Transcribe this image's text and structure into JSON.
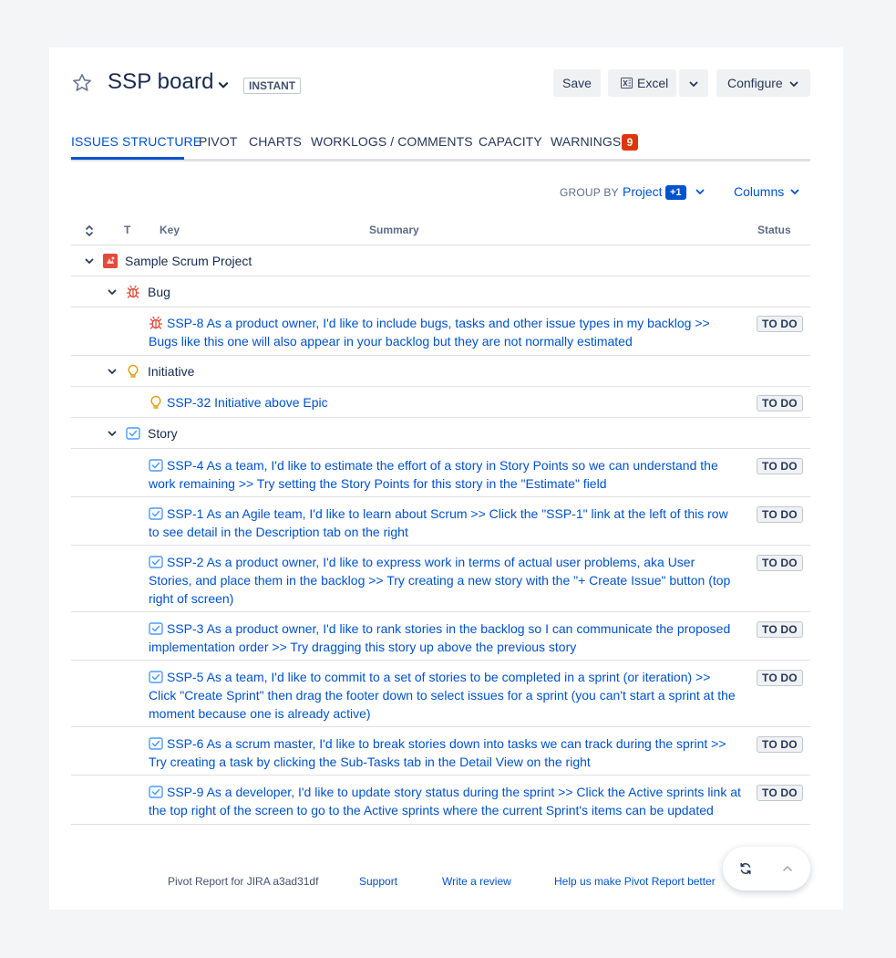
{
  "header": {
    "title": "SSP board",
    "badge": "INSTANT",
    "save_label": "Save",
    "excel_label": "Excel",
    "configure_label": "Configure"
  },
  "tabs": [
    {
      "label": "ISSUES STRUCTURE",
      "active": true
    },
    {
      "label": "PIVOT",
      "active": false
    },
    {
      "label": "CHARTS",
      "active": false
    },
    {
      "label": "WORKLOGS / COMMENTS",
      "active": false
    },
    {
      "label": "CAPACITY",
      "active": false
    },
    {
      "label": "WARNINGS",
      "active": false,
      "count": "9"
    }
  ],
  "groupby": {
    "label": "GROUP BY",
    "value": "Project",
    "extra": "+1",
    "columns_label": "Columns"
  },
  "table": {
    "headers": {
      "type": "T",
      "key": "Key",
      "summary": "Summary",
      "status": "Status"
    },
    "project": "Sample Scrum Project",
    "groups": [
      {
        "label": "Bug",
        "icon": "bug-icon",
        "issues": [
          {
            "text": "SSP-8 As a product owner, I'd like to include bugs, tasks and other issue types in my backlog >> Bugs like this one will also appear in your backlog but they are not normally estimated",
            "status": "TO DO"
          }
        ]
      },
      {
        "label": "Initiative",
        "icon": "lightbulb-icon",
        "issues": [
          {
            "text": "SSP-32 Initiative above Epic",
            "status": "TO DO"
          }
        ]
      },
      {
        "label": "Story",
        "icon": "checkbox-icon",
        "issues": [
          {
            "text": "SSP-4 As a team, I'd like to estimate the effort of a story in Story Points so we can understand the work remaining >> Try setting the Story Points for this story in the \"Estimate\" field",
            "status": "TO DO"
          },
          {
            "text": "SSP-1 As an Agile team, I'd like to learn about Scrum >> Click the \"SSP-1\" link at the left of this row to see detail in the Description tab on the right",
            "status": "TO DO"
          },
          {
            "text": "SSP-2 As a product owner, I'd like to express work in terms of actual user problems, aka User Stories, and place them in the backlog >> Try creating a new story with the \"+ Create Issue\" button (top right of screen)",
            "status": "TO DO"
          },
          {
            "text": "SSP-3 As a product owner, I'd like to rank stories in the backlog so I can communicate the proposed implementation order >> Try dragging this story up above the previous story",
            "status": "TO DO"
          },
          {
            "text": "SSP-5 As a team, I'd like to commit to a set of stories to be completed in a sprint (or iteration) >> Click \"Create Sprint\" then drag the footer down to select issues for a sprint (you can't start a sprint at the moment because one is already active)",
            "status": "TO DO"
          },
          {
            "text": "SSP-6 As a scrum master, I'd like to break stories down into tasks we can track during the sprint >> Try creating a task by clicking the Sub-Tasks tab in the Detail View on the right",
            "status": "TO DO"
          },
          {
            "text": "SSP-9 As a developer, I'd like to update story status during the sprint >> Click the Active sprints link at the top right of the screen to go to the Active sprints where the current Sprint's items can be updated",
            "status": "TO DO"
          }
        ]
      }
    ]
  },
  "footer": {
    "version": "Pivot Report for JIRA a3ad31df",
    "support": "Support",
    "review": "Write a review",
    "feedback": "Help us make Pivot Report better"
  },
  "colors": {
    "accent": "#0052cc",
    "warning": "#de350b",
    "bug": "#e5493a",
    "initiative": "#d99a00",
    "story": "#4c9aff",
    "project": "#e5493a"
  }
}
